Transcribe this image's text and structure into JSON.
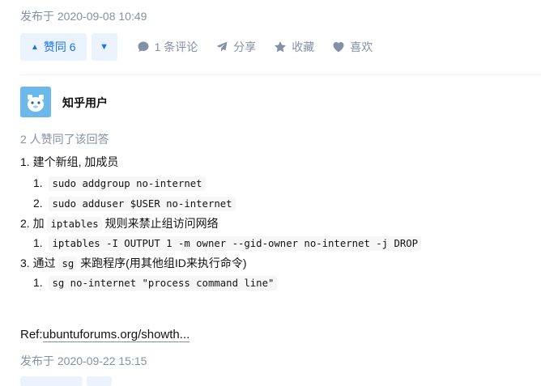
{
  "answer1": {
    "published": "发布于 2020-09-08 10:49"
  },
  "actions": {
    "upvote_label": "赞同 6",
    "comments_label": "1 条评论",
    "share_label": "分享",
    "collect_label": "收藏",
    "like_label": "喜欢"
  },
  "author": {
    "name": "知乎用户"
  },
  "likers_text": "2 人赞同了该回答",
  "content": {
    "item1": {
      "num": "1.",
      "text": "建个新组, 加成员"
    },
    "item1_sub": [
      {
        "num": "1.",
        "code": "sudo addgroup no-internet"
      },
      {
        "num": "2.",
        "code": "sudo adduser $USER no-internet"
      }
    ],
    "item2": {
      "num": "2.",
      "pre": "加",
      "code": "iptables",
      "post": "规则来禁止组访问网络"
    },
    "item2_sub": [
      {
        "num": "1.",
        "code": "iptables -I OUTPUT 1 -m owner --gid-owner no-internet -j DROP"
      }
    ],
    "item3": {
      "num": "3.",
      "pre": "通过",
      "code": "sg",
      "post": "来跑程序(用其他组ID来执行命令)"
    },
    "item3_sub": [
      {
        "num": "1.",
        "code": "sg no-internet \"process command line\""
      }
    ]
  },
  "ref": {
    "prefix": "Ref:",
    "link": "ubuntuforums.org/showth..."
  },
  "answer2": {
    "published": "发布于 2020-09-22 15:15"
  }
}
